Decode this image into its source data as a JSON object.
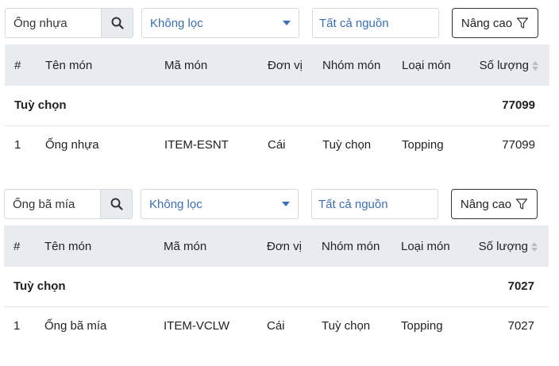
{
  "colors": {
    "accent": "#3a6fb5",
    "header_bg": "#e9ecef",
    "border": "#d5d8dc"
  },
  "panels": [
    {
      "search": {
        "value": "Ống nhựa",
        "icon": "search-icon"
      },
      "filter": {
        "selected": "Không lọc"
      },
      "source": {
        "selected": "Tất cả nguồn"
      },
      "advanced": {
        "label": "Nâng cao",
        "icon": "filter-icon"
      },
      "columns": [
        "#",
        "Tên món",
        "Mã món",
        "Đơn vị",
        "Nhóm món",
        "Loại món",
        "Số lượng"
      ],
      "group": {
        "label": "Tuỳ chọn",
        "total": "77099"
      },
      "rows": [
        {
          "index": "1",
          "name": "Ống nhựa",
          "code": "ITEM-ESNT",
          "unit": "Cái",
          "group": "Tuỳ chọn",
          "type": "Topping",
          "qty": "77099"
        }
      ]
    },
    {
      "search": {
        "value": "Ống bã mía",
        "icon": "search-icon"
      },
      "filter": {
        "selected": "Không lọc"
      },
      "source": {
        "selected": "Tất cả nguồn"
      },
      "advanced": {
        "label": "Nâng cao",
        "icon": "filter-icon"
      },
      "columns": [
        "#",
        "Tên món",
        "Mã món",
        "Đơn vị",
        "Nhóm món",
        "Loại món",
        "Số lượng"
      ],
      "group": {
        "label": "Tuỳ chọn",
        "total": "7027"
      },
      "rows": [
        {
          "index": "1",
          "name": "Ống bã mía",
          "code": "ITEM-VCLW",
          "unit": "Cái",
          "group": "Tuỳ chọn",
          "type": "Topping",
          "qty": "7027"
        }
      ]
    }
  ]
}
